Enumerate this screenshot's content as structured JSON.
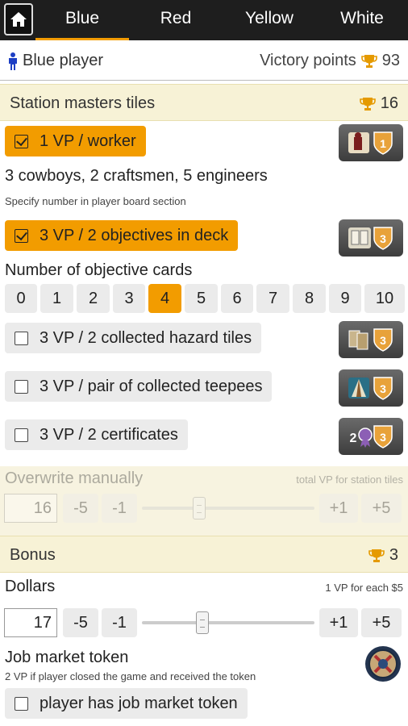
{
  "nav": {
    "tabs": [
      {
        "label": "Blue",
        "active": true
      },
      {
        "label": "Red",
        "active": false
      },
      {
        "label": "Yellow",
        "active": false
      },
      {
        "label": "White",
        "active": false
      }
    ]
  },
  "player": {
    "name": "Blue player",
    "vp_label": "Victory points",
    "vp_value": "93"
  },
  "station": {
    "title": "Station masters tiles",
    "score": "16",
    "worker_option": {
      "label": "1 VP / worker",
      "checked": true
    },
    "worker_detail": "3 cowboys, 2 craftsmen, 5 engineers",
    "worker_note": "Specify number in player board section",
    "objectives_option": {
      "label": "3 VP / 2 objectives in deck",
      "checked": true
    },
    "objective_cards_label": "Number of objective cards",
    "objective_numbers": [
      "0",
      "1",
      "2",
      "3",
      "4",
      "5",
      "6",
      "7",
      "8",
      "9",
      "10"
    ],
    "objective_selected": "4",
    "hazard_option": {
      "label": "3 VP / 2 collected hazard tiles",
      "checked": false
    },
    "teepee_option": {
      "label": "3 VP / pair of collected teepees",
      "checked": false
    },
    "certificate_option": {
      "label": "3 VP / 2 certificates",
      "checked": false
    },
    "tile_badges": [
      "1",
      "3",
      "3",
      "3",
      "3"
    ],
    "certificate_tile_prefix": "2"
  },
  "overwrite": {
    "label": "Overwrite manually",
    "note": "total VP for station tiles",
    "value": "16",
    "minus5": "-5",
    "minus1": "-1",
    "plus1": "+1",
    "plus5": "+5",
    "slider_fraction": 0.33
  },
  "bonus": {
    "title": "Bonus",
    "score": "3",
    "dollars_label": "Dollars",
    "dollars_note": "1 VP for each $5",
    "dollars_value": "17",
    "minus5": "-5",
    "minus1": "-1",
    "plus1": "+1",
    "plus5": "+5",
    "slider_fraction": 0.35,
    "job_token_label": "Job market token",
    "job_token_note": "2 VP if player closed the game and received the token",
    "job_token_option": {
      "label": "player has job market token",
      "checked": false
    }
  },
  "colors": {
    "accent": "#f29c00",
    "nav_bg": "#1e1e1e",
    "section_bg": "#f7f2d6",
    "player_icon": "#1d3fc4",
    "trophy": "#e59a00"
  },
  "icons": [
    "home-icon",
    "person-icon",
    "trophy-icon",
    "checkbox-icon",
    "worker-tile-icon",
    "objective-tile-icon",
    "hazard-tile-icon",
    "teepee-tile-icon",
    "certificate-tile-icon",
    "job-market-token-icon"
  ]
}
